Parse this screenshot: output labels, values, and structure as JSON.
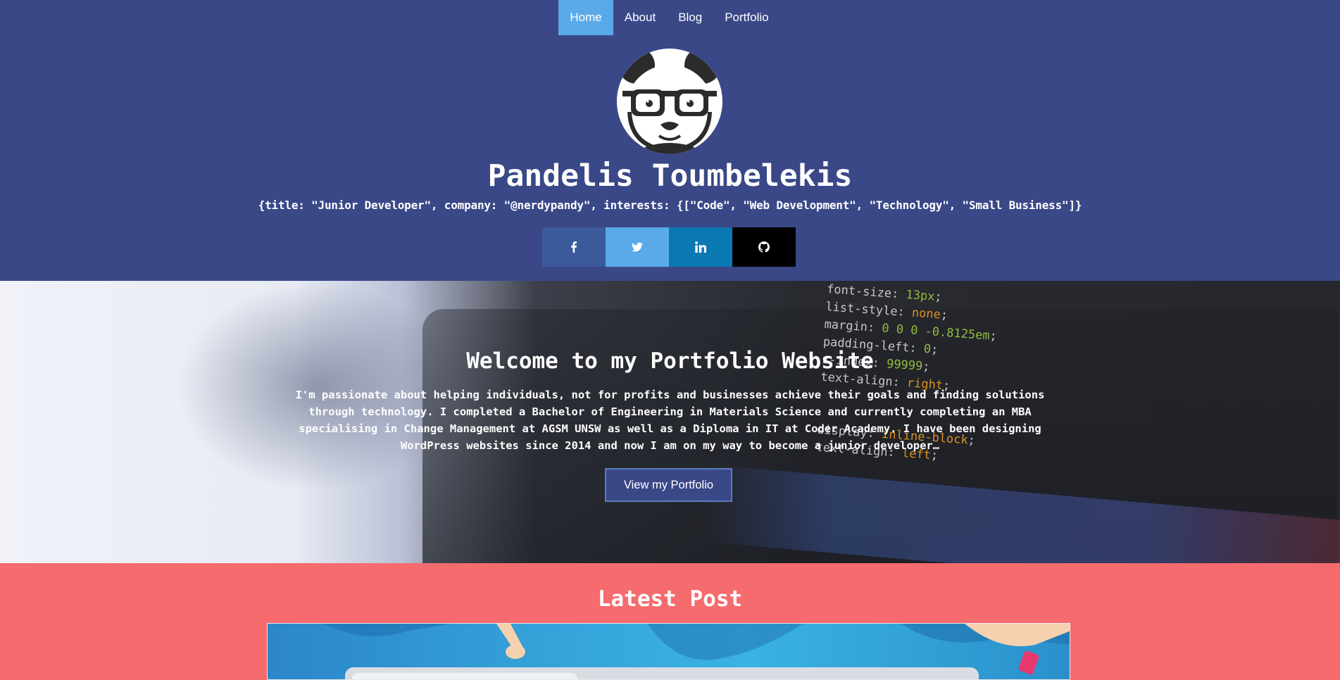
{
  "nav": {
    "items": [
      {
        "label": "Home",
        "active": true
      },
      {
        "label": "About",
        "active": false
      },
      {
        "label": "Blog",
        "active": false
      },
      {
        "label": "Portfolio",
        "active": false
      }
    ]
  },
  "header": {
    "name": "Pandelis Toumbelekis",
    "tagline": "{title: \"Junior Developer\", company: \"@nerdypandy\", interests: {[\"Code\", \"Web Development\", \"Technology\", \"Small Business\"]}",
    "avatar_icon": "panda-with-glasses-icon",
    "social": [
      {
        "icon": "facebook-icon",
        "color": "#3a5a9a"
      },
      {
        "icon": "twitter-icon",
        "color": "#5aaae9"
      },
      {
        "icon": "linkedin-icon",
        "color": "#0c78b2"
      },
      {
        "icon": "github-icon",
        "color": "#000000"
      }
    ]
  },
  "hero": {
    "title": "Welcome to my Portfolio Website",
    "text": "I'm passionate about helping individuals, not for profits and businesses achieve their goals and finding solutions through technology. I completed a Bachelor of Engineering in Materials Science and currently completing an MBA specialising in Change Management at AGSM UNSW as well as a Diploma in IT at Coder Academy. I have been designing WordPress websites since 2014 and now I am on my way to become a junior developer…",
    "button_label": "View my Portfolio",
    "code_lines": [
      {
        "prop": "font-size:",
        "val": "13px",
        "cls": "v"
      },
      {
        "prop": "list-style:",
        "val": "none",
        "cls": "o"
      },
      {
        "prop": "margin:",
        "val": "0 0 0 -0.8125em",
        "cls": "v"
      },
      {
        "prop": "padding-left:",
        "val": "0",
        "cls": "v"
      },
      {
        "prop": "z-index:",
        "val": "99999",
        "cls": "v"
      },
      {
        "prop": "text-align:",
        "val": "right",
        "cls": "o"
      },
      {
        "prop": "",
        "val": "",
        "cls": "v"
      },
      {
        "prop": "",
        "val": "",
        "cls": "v"
      },
      {
        "prop": "display:",
        "val": "inline-block",
        "cls": "o"
      },
      {
        "prop": "text-align:",
        "val": "left",
        "cls": "o"
      }
    ]
  },
  "latest": {
    "title": "Latest Post"
  },
  "colors": {
    "primary": "#3a4888",
    "accent": "#5aaae9",
    "coral": "#f66b6e"
  }
}
